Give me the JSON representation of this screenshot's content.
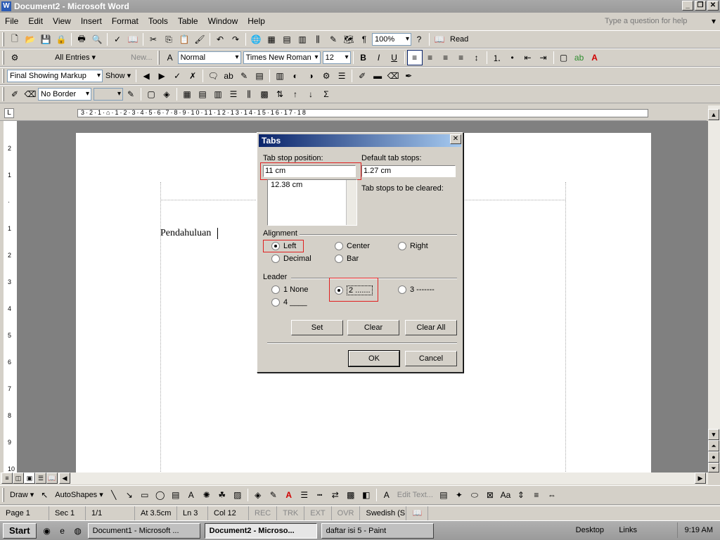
{
  "window": {
    "title": "Document2 - Microsoft Word",
    "help_placeholder": "Type a question for help"
  },
  "menu": [
    "File",
    "Edit",
    "View",
    "Insert",
    "Format",
    "Tools",
    "Table",
    "Window",
    "Help"
  ],
  "toolbar1": {
    "zoom": "100%",
    "read_label": "Read"
  },
  "toolbar2": {
    "autotext": "All Entries ▾",
    "new_label": "New...",
    "style": "Normal",
    "font": "Times New Roman",
    "size": "12"
  },
  "toolbar3": {
    "markup": "Final Showing Markup",
    "show_label": "Show ▾"
  },
  "toolbar4": {
    "border": "No Border"
  },
  "ruler": {
    "numbers": "3·2·1·⌂·1·2·3·4·5·6·7·8·9·10·11·12·13·14·15·16·17·18"
  },
  "document": {
    "text": "Pendahuluan"
  },
  "dialog": {
    "title": "Tabs",
    "tab_stop_label": "Tab stop position:",
    "tab_stop_value": "11 cm",
    "tab_stop_list": [
      "12.38 cm"
    ],
    "default_label": "Default tab stops:",
    "default_value": "1.27 cm",
    "cleared_label": "Tab stops to be cleared:",
    "alignment_label": "Alignment",
    "alignment": [
      "Left",
      "Center",
      "Right",
      "Decimal",
      "Bar"
    ],
    "leader_label": "Leader",
    "leader": [
      "1 None",
      "2 .......",
      "3 -------",
      "4 ____"
    ],
    "buttons": {
      "set": "Set",
      "clear": "Clear",
      "clear_all": "Clear All",
      "ok": "OK",
      "cancel": "Cancel"
    }
  },
  "drawbar": {
    "draw": "Draw ▾",
    "autoshapes": "AutoShapes ▾",
    "edit_text": "Edit Text..."
  },
  "status": {
    "page": "Page 1",
    "sec": "Sec 1",
    "pages": "1/1",
    "at": "At 3.5cm",
    "ln": "Ln 3",
    "col": "Col 12",
    "rec": "REC",
    "trk": "TRK",
    "ext": "EXT",
    "ovr": "OVR",
    "lang": "Swedish (S"
  },
  "taskbar": {
    "start": "Start",
    "tasks": [
      "Document1 - Microsoft ...",
      "Document2 - Microso...",
      "daftar isi 5 - Paint"
    ],
    "desktop": "Desktop",
    "links": "Links",
    "time": "9:19 AM"
  }
}
